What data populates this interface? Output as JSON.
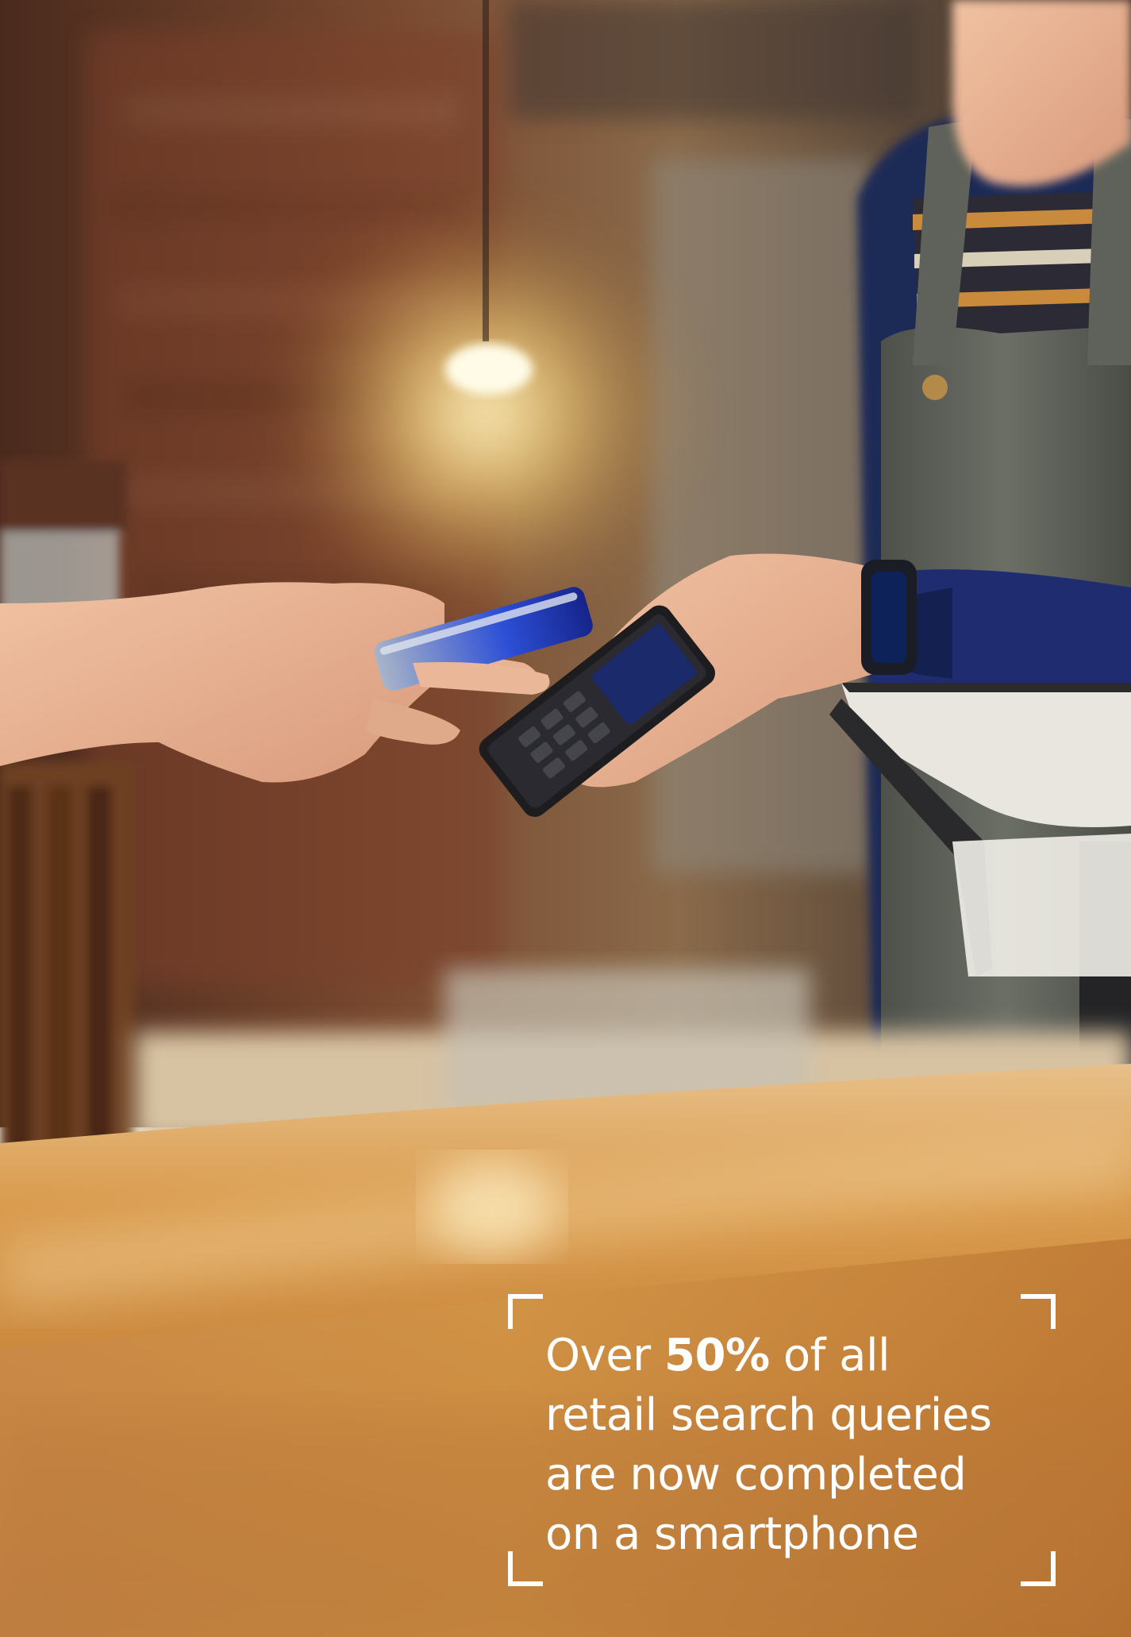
{
  "colors": {
    "text": "#ffffff",
    "counter_wood": "#c98a3c",
    "wall_brick": "#6b3a25",
    "apron": "#5f6258",
    "shirt_navy": "#1f2d5c"
  },
  "callout": {
    "pre": "Over",
    "highlight": "50%",
    "post": "of all",
    "line2": "retail search queries",
    "line3": "are now completed",
    "line4": "on a smartphone"
  }
}
